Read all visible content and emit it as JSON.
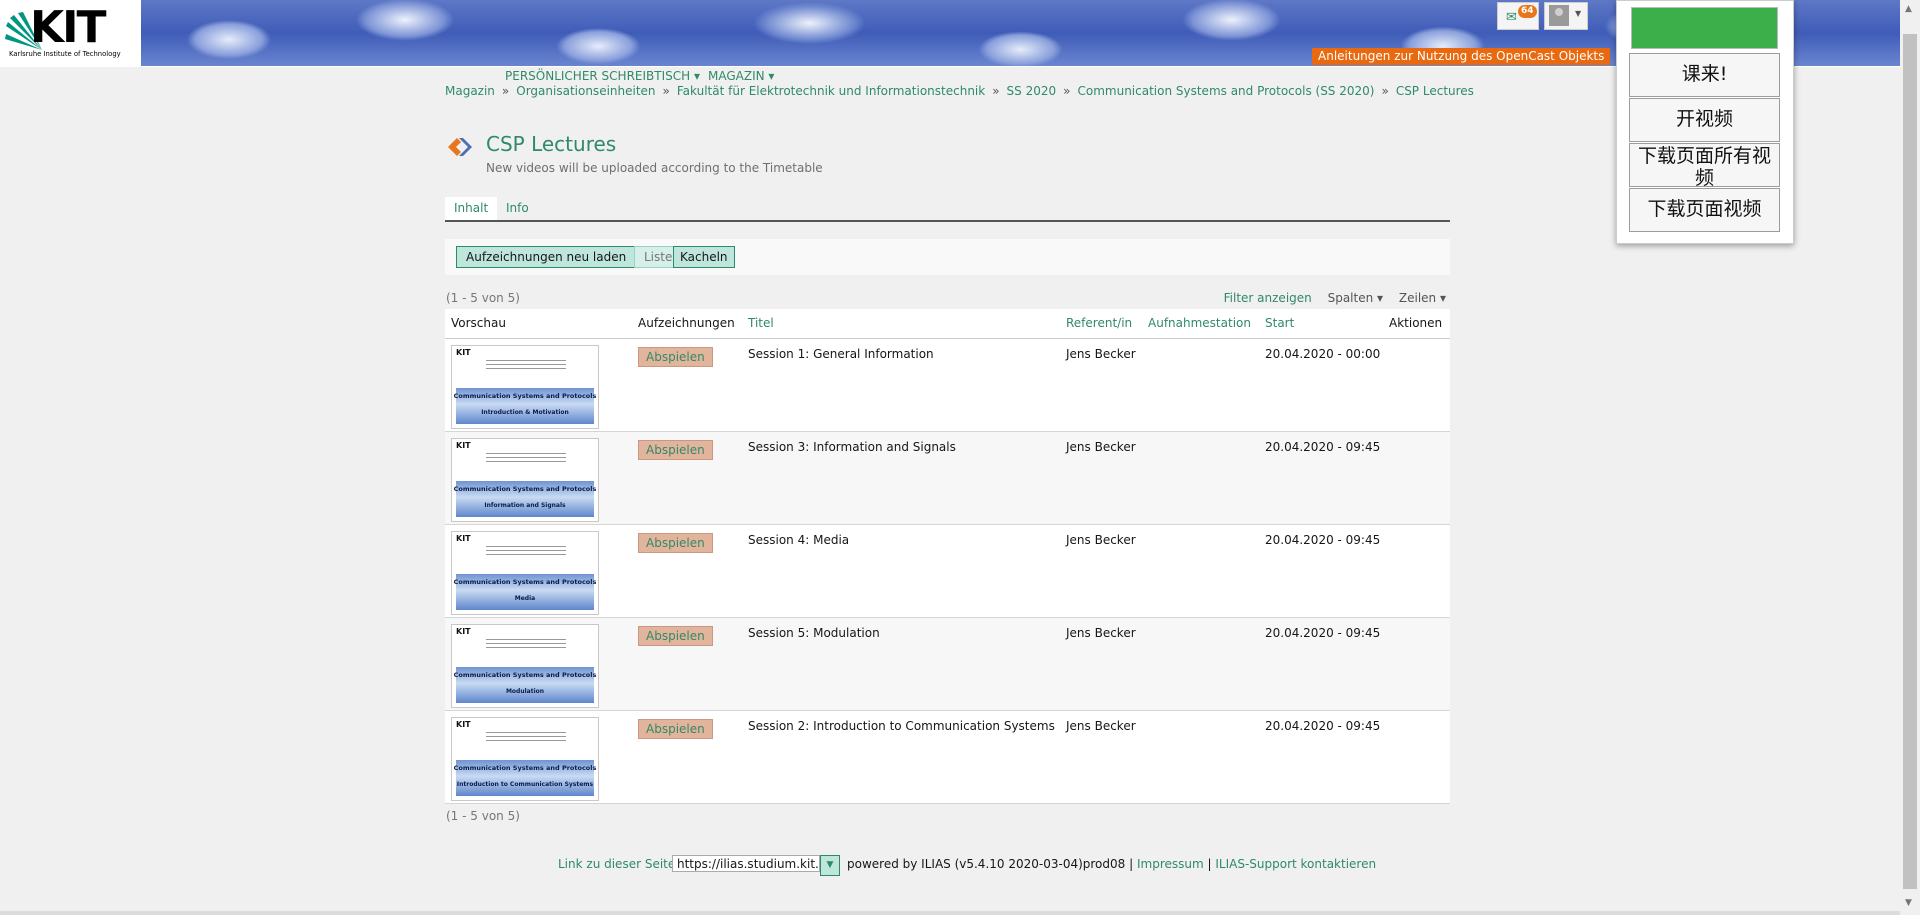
{
  "header": {
    "logo_word": "KIT",
    "logo_sub": "Karlsruhe Institute of Technology",
    "mail_count": "64",
    "opencast_link": "Anleitungen zur Nutzung des OpenCast Objekts",
    "menu": [
      "Persönlicher Schreibtisch",
      "Magazin"
    ]
  },
  "breadcrumb": [
    "Magazin",
    "Organisationseinheiten",
    "Fakultät für Elektrotechnik und Informationstechnik",
    "SS 2020",
    "Communication Systems and Protocols (SS 2020)",
    "CSP Lectures"
  ],
  "page": {
    "title": "CSP Lectures",
    "description": "New videos will be uploaded according to the Timetable",
    "tabs": [
      "Inhalt",
      "Info"
    ]
  },
  "toolbar": {
    "reload_label": "Aufzeichnungen neu laden",
    "liste_label": "Liste",
    "kacheln_label": "Kacheln"
  },
  "table": {
    "count_text": "(1 - 5 von 5)",
    "controls": [
      "Filter anzeigen",
      "Spalten",
      "Zeilen"
    ],
    "headers": [
      "Vorschau",
      "Aufzeichnungen",
      "Titel",
      "Referent/in",
      "Aufnahmestation",
      "Start",
      "Aktionen"
    ],
    "play_label": "Abspielen",
    "rows": [
      {
        "title": "Session 1: General Information",
        "speaker": "Jens Becker",
        "start": "20.04.2020 - 00:00",
        "thumb_title": "Communication Systems and Protocols",
        "thumb_subtitle": "Introduction & Motivation"
      },
      {
        "title": "Session 3: Information and Signals",
        "speaker": "Jens Becker",
        "start": "20.04.2020 - 09:45",
        "thumb_title": "Communication Systems and Protocols",
        "thumb_subtitle": "Information and Signals"
      },
      {
        "title": "Session 4: Media",
        "speaker": "Jens Becker",
        "start": "20.04.2020 - 09:45",
        "thumb_title": "Communication Systems and Protocols",
        "thumb_subtitle": "Media"
      },
      {
        "title": "Session 5: Modulation",
        "speaker": "Jens Becker",
        "start": "20.04.2020 - 09:45",
        "thumb_title": "Communication Systems and Protocols",
        "thumb_subtitle": "Modulation"
      },
      {
        "title": "Session 2: Introduction to Communication Systems",
        "speaker": "Jens Becker",
        "start": "20.04.2020 - 09:45",
        "thumb_title": "Communication Systems and Protocols",
        "thumb_subtitle": "Introduction to Communication Systems"
      }
    ]
  },
  "footer": {
    "link_label": "Link zu dieser Seite:",
    "link_value": "https://ilias.studium.kit.e",
    "powered": "powered by ILIAS (v5.4.10 2020-03-04)prod08",
    "impressum": "Impressum",
    "support": "ILIAS-Support kontaktieren"
  },
  "extension": {
    "buttons": [
      "课来!",
      "开视频",
      "下载页面所有视频",
      "下载页面视频"
    ]
  },
  "colors": {
    "accent": "#2f8a68",
    "opencast": "#e8690f",
    "play_button": "#e3b49c",
    "ext_green": "#3cae4a"
  }
}
